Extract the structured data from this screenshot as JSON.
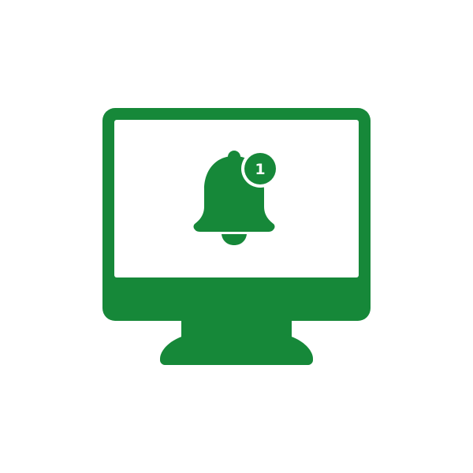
{
  "icon": {
    "name": "desktop-notification-icon",
    "monitor_icon": "monitor-icon",
    "bell_icon": "bell-icon",
    "badge_icon": "notification-badge-icon"
  },
  "notification": {
    "count": "1"
  },
  "colors": {
    "primary": "#168839",
    "background": "#ffffff",
    "screen": "#ffffff"
  }
}
